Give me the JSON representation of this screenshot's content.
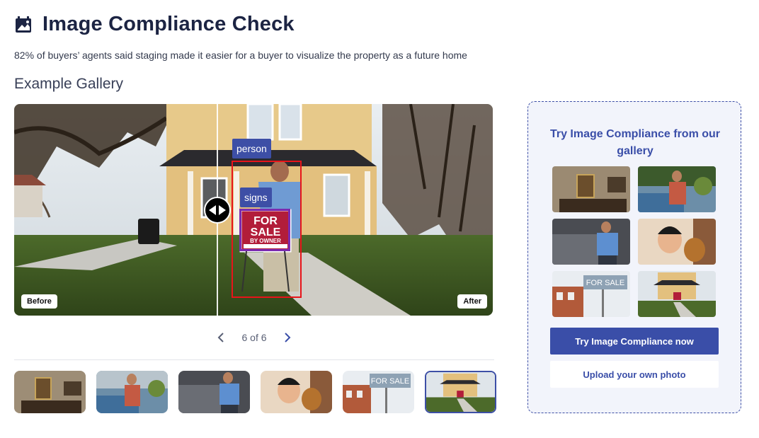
{
  "header": {
    "title": "Image Compliance Check",
    "icon": "image-check-icon",
    "subtitle": "82% of buyers’ agents said staging made it easier for a buyer to visualize the property as a future home"
  },
  "gallery": {
    "title": "Example Gallery",
    "viewer": {
      "detections": [
        {
          "label": "person"
        },
        {
          "label": "signs"
        }
      ],
      "sign_text": {
        "line1": "FOR",
        "line2": "SALE",
        "line3": "BY OWNER"
      },
      "before_label": "Before",
      "after_label": "After"
    },
    "pager": {
      "text": "6 of 6",
      "prev_icon": "chevron-left-icon",
      "next_icon": "chevron-right-icon"
    },
    "thumbnails": [
      {
        "name": "room-portrait"
      },
      {
        "name": "man-with-car"
      },
      {
        "name": "man-leaning-car"
      },
      {
        "name": "child-with-cat"
      },
      {
        "name": "for-sale-sign",
        "text": "FOR SALE"
      },
      {
        "name": "house-with-sign",
        "active": true
      }
    ]
  },
  "panel": {
    "title": "Try Image Compliance from our gallery",
    "grid": [
      {
        "name": "room-portrait"
      },
      {
        "name": "man-with-car"
      },
      {
        "name": "man-leaning-car"
      },
      {
        "name": "child-with-cat"
      },
      {
        "name": "for-sale-sign",
        "text": "FOR SALE"
      },
      {
        "name": "house-with-sign"
      }
    ],
    "primary_button": "Try Image Compliance now",
    "secondary_button": "Upload your own photo"
  },
  "colors": {
    "accent": "#3a4ea8",
    "bbox_person": "#e8141a",
    "bbox_signs": "#7b2bb0",
    "panel_bg": "#f2f4fb"
  }
}
